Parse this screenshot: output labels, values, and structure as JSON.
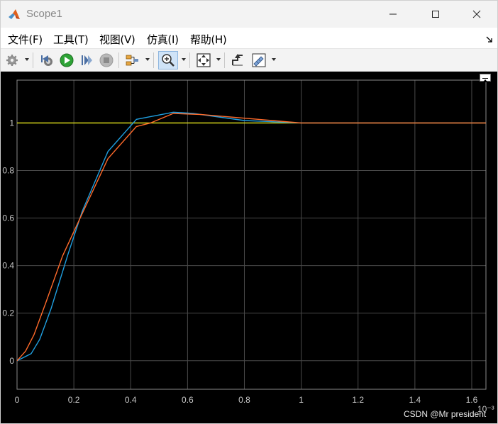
{
  "window": {
    "title": "Scope1"
  },
  "menu": {
    "items": [
      "文件(F)",
      "工具(T)",
      "视图(V)",
      "仿真(I)",
      "帮助(H)"
    ]
  },
  "toolbar": {
    "buttons": [
      {
        "name": "settings",
        "icon": "gear-icon"
      },
      {
        "name": "step-back",
        "icon": "step-back-icon"
      },
      {
        "name": "run",
        "icon": "run-icon"
      },
      {
        "name": "step-forward",
        "icon": "step-forward-icon"
      },
      {
        "name": "stop",
        "icon": "stop-icon"
      },
      {
        "name": "signal-selector",
        "icon": "signal-selector-icon"
      },
      {
        "name": "zoom-in",
        "icon": "zoom-in-icon"
      },
      {
        "name": "autoscale",
        "icon": "autoscale-icon"
      },
      {
        "name": "triggers",
        "icon": "triggers-icon"
      },
      {
        "name": "measurements",
        "icon": "measurements-icon"
      }
    ]
  },
  "colors": {
    "background": "#000000",
    "grid": "#4a4a4a",
    "reference": "#e6e619",
    "response_blue": "#1f9fe0",
    "response_orange": "#ff6a2a"
  },
  "chart_data": {
    "type": "line",
    "xlim": [
      0,
      1.65
    ],
    "ylim": [
      -0.12,
      1.18
    ],
    "xticks": [
      0,
      0.2,
      0.4,
      0.6,
      0.8,
      1,
      1.2,
      1.4,
      1.6
    ],
    "xtick_labels": [
      "0",
      "0.2",
      "0.4",
      "0.6",
      "0.8",
      "1",
      "1.2",
      "1.4",
      "1.6"
    ],
    "yticks": [
      0,
      0.2,
      0.4,
      0.6,
      0.8,
      1
    ],
    "ytick_labels": [
      "0",
      "0.2",
      "0.4",
      "0.6",
      "0.8",
      "1"
    ],
    "x_exponent_label": "10⁻³",
    "grid": true,
    "series": [
      {
        "color": "#e6e619",
        "x": [
          0,
          1.65
        ],
        "y": [
          1.0,
          1.0
        ]
      },
      {
        "color": "#1f9fe0",
        "x": [
          0,
          0.05,
          0.08,
          0.12,
          0.18,
          0.23,
          0.32,
          0.42,
          0.55,
          0.62,
          0.8,
          1.0,
          1.2,
          1.65
        ],
        "y": [
          0,
          0.03,
          0.09,
          0.22,
          0.45,
          0.63,
          0.88,
          1.015,
          1.045,
          1.04,
          1.01,
          1.0,
          1.0,
          1.0
        ]
      },
      {
        "color": "#ff6a2a",
        "x": [
          0,
          0.03,
          0.06,
          0.1,
          0.16,
          0.23,
          0.32,
          0.42,
          0.47,
          0.55,
          0.65,
          0.8,
          1.0,
          1.2,
          1.65
        ],
        "y": [
          0,
          0.04,
          0.11,
          0.24,
          0.44,
          0.62,
          0.85,
          0.985,
          1.0,
          1.04,
          1.035,
          1.02,
          1.0,
          1.0,
          1.0
        ]
      }
    ]
  },
  "watermark": {
    "text": "CSDN @Mr president"
  }
}
